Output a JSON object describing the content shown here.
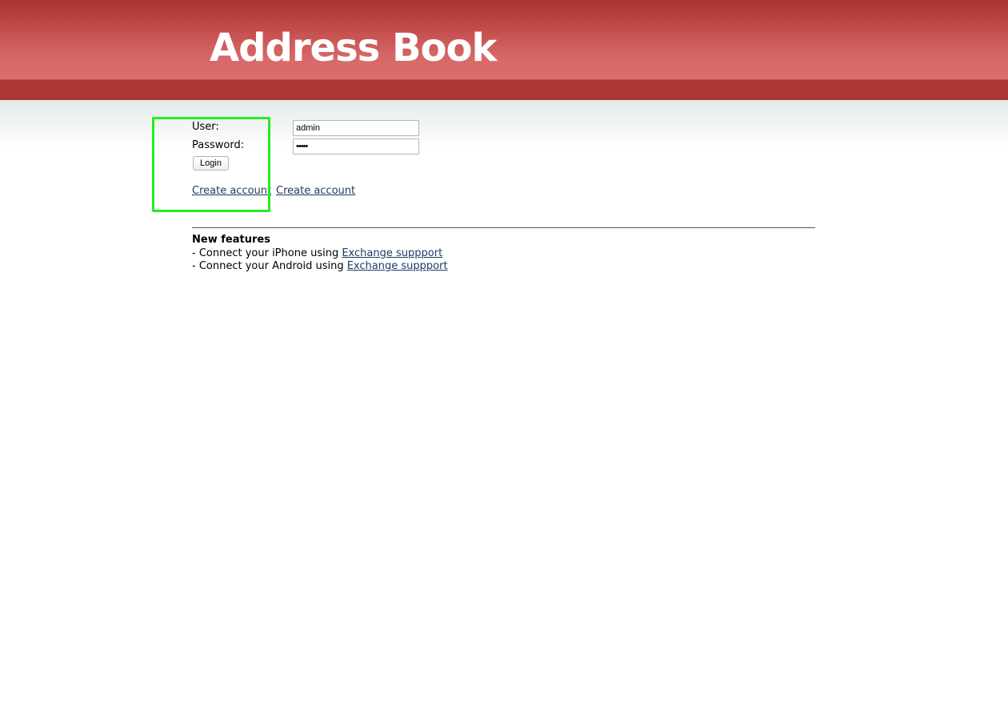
{
  "header": {
    "title": "Address Book"
  },
  "login_form": {
    "user_label": "User:",
    "user_value": "admin",
    "password_label": "Password:",
    "password_value": "•••••",
    "login_button": "Login",
    "create_account_link_1": "Create account",
    "create_account_link_2": "Create account"
  },
  "features": {
    "heading": "New features",
    "items": [
      {
        "prefix": "- Connect your iPhone using ",
        "link": "Exchange suppport"
      },
      {
        "prefix": "- Connect your Android using ",
        "link": "Exchange suppport"
      }
    ]
  },
  "colors": {
    "header_red": "#ab3634",
    "link_blue": "#1f3a66",
    "highlight_green": "#22ee22"
  }
}
